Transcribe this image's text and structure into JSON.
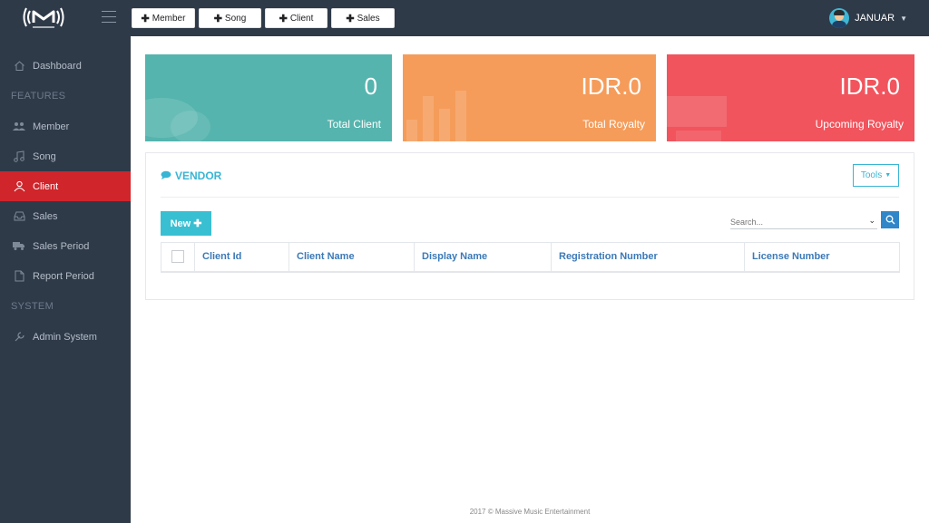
{
  "brand": {
    "logo_text": "MASSIVE MUSIC"
  },
  "quick_actions": [
    {
      "label": "Member"
    },
    {
      "label": "Song"
    },
    {
      "label": "Client"
    },
    {
      "label": "Sales"
    }
  ],
  "user": {
    "name": "JANUAR"
  },
  "sidebar": {
    "dashboard": "Dashboard",
    "features_heading": "FEATURES",
    "member": "Member",
    "song": "Song",
    "client": "Client",
    "sales": "Sales",
    "sales_period": "Sales Period",
    "report_period": "Report Period",
    "system_heading": "SYSTEM",
    "admin_system": "Admin System"
  },
  "stats": {
    "total_client": {
      "value": "0",
      "label": "Total Client",
      "color": "#55b4ae"
    },
    "total_royalty": {
      "value": "IDR.0",
      "label": "Total Royalty",
      "color": "#f59c5a"
    },
    "upcoming_royalty": {
      "value": "IDR.0",
      "label": "Upcoming Royalty",
      "color": "#f1545d"
    }
  },
  "panel": {
    "title": "VENDOR",
    "tools_label": "Tools",
    "new_label": "New",
    "search_placeholder": "Search...",
    "columns": [
      "Client Id",
      "Client Name",
      "Display Name",
      "Registration Number",
      "License Number"
    ]
  },
  "footer": {
    "text": "2017 © Massive Music Entertainment"
  },
  "colors": {
    "sidebar_bg": "#2f3a49",
    "active_red": "#d0252b",
    "accent_cyan": "#39b5d4",
    "header_blue": "#3b79b8"
  }
}
